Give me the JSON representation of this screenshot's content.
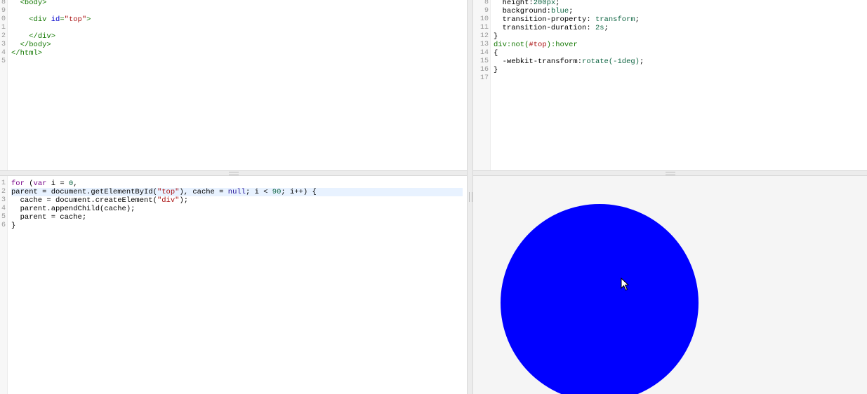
{
  "html_panel": {
    "lines": [
      {
        "n": "8",
        "parts": [
          {
            "t": "  "
          },
          {
            "t": "<body>",
            "c": "tag"
          }
        ]
      },
      {
        "n": "9",
        "parts": [
          {
            "t": ""
          }
        ]
      },
      {
        "n": "0",
        "parts": [
          {
            "t": "    "
          },
          {
            "t": "<div ",
            "c": "tag"
          },
          {
            "t": "id",
            "c": "attr"
          },
          {
            "t": "=",
            "c": "tag"
          },
          {
            "t": "\"top\"",
            "c": "str"
          },
          {
            "t": ">",
            "c": "tag"
          }
        ]
      },
      {
        "n": "1",
        "parts": [
          {
            "t": ""
          }
        ]
      },
      {
        "n": "2",
        "parts": [
          {
            "t": "    "
          },
          {
            "t": "</div>",
            "c": "tag"
          }
        ]
      },
      {
        "n": "3",
        "parts": [
          {
            "t": "  "
          },
          {
            "t": "</body>",
            "c": "tag"
          }
        ]
      },
      {
        "n": "4",
        "parts": [
          {
            "t": "</html>",
            "c": "tag"
          }
        ]
      },
      {
        "n": "5",
        "parts": [
          {
            "t": ""
          }
        ]
      }
    ]
  },
  "css_panel": {
    "lines": [
      {
        "n": "8",
        "parts": [
          {
            "t": "  height",
            "c": "prop"
          },
          {
            "t": ":"
          },
          {
            "t": "200px",
            "c": "val"
          },
          {
            "t": ";"
          }
        ]
      },
      {
        "n": "9",
        "parts": [
          {
            "t": "  background",
            "c": "prop"
          },
          {
            "t": ":"
          },
          {
            "t": "blue",
            "c": "val"
          },
          {
            "t": ";"
          }
        ]
      },
      {
        "n": "10",
        "parts": [
          {
            "t": "  transition-property",
            "c": "prop"
          },
          {
            "t": ": "
          },
          {
            "t": "transform",
            "c": "val"
          },
          {
            "t": ";"
          }
        ]
      },
      {
        "n": "11",
        "parts": [
          {
            "t": "  transition-duration",
            "c": "prop"
          },
          {
            "t": ": "
          },
          {
            "t": "2s",
            "c": "val"
          },
          {
            "t": ";"
          }
        ]
      },
      {
        "n": "12",
        "parts": [
          {
            "t": "}"
          }
        ]
      },
      {
        "n": "13",
        "parts": [
          {
            "t": "div",
            "c": "selector"
          },
          {
            "t": ":not(",
            "c": "selector"
          },
          {
            "t": "#top",
            "c": "str"
          },
          {
            "t": "):hover",
            "c": "selector"
          }
        ]
      },
      {
        "n": "14",
        "parts": [
          {
            "t": "{"
          }
        ]
      },
      {
        "n": "15",
        "parts": [
          {
            "t": "  -webkit-transform",
            "c": "prop"
          },
          {
            "t": ":"
          },
          {
            "t": "rotate",
            "c": "val"
          },
          {
            "t": "(-1deg)",
            "c": "val"
          },
          {
            "t": ";"
          }
        ]
      },
      {
        "n": "16",
        "parts": [
          {
            "t": "}"
          }
        ]
      },
      {
        "n": "17",
        "parts": [
          {
            "t": ""
          }
        ]
      }
    ]
  },
  "js_panel": {
    "lines": [
      {
        "n": "1",
        "parts": [
          {
            "t": "for",
            "c": "kw"
          },
          {
            "t": " ("
          },
          {
            "t": "var",
            "c": "kw"
          },
          {
            "t": " i = "
          },
          {
            "t": "0",
            "c": "num"
          },
          {
            "t": ","
          }
        ]
      },
      {
        "n": "2",
        "hl": true,
        "parts": [
          {
            "t": "parent = document.getElementById("
          },
          {
            "t": "\"top\"",
            "c": "str"
          },
          {
            "t": "), cache = "
          },
          {
            "t": "null",
            "c": "atom"
          },
          {
            "t": "; i < "
          },
          {
            "t": "90",
            "c": "num"
          },
          {
            "t": "; i++) {"
          }
        ]
      },
      {
        "n": "3",
        "parts": [
          {
            "t": "  cache = document.createElement("
          },
          {
            "t": "\"div\"",
            "c": "str"
          },
          {
            "t": ");"
          }
        ]
      },
      {
        "n": "4",
        "parts": [
          {
            "t": "  parent.appendChild(cache);"
          }
        ]
      },
      {
        "n": "5",
        "parts": [
          {
            "t": "  parent = cache;"
          }
        ]
      },
      {
        "n": "6",
        "parts": [
          {
            "t": "}"
          }
        ]
      }
    ]
  },
  "result_panel": {
    "shape": "blue-circle",
    "color": "#0000ff",
    "cursor_icon": "arrow-pointer-icon"
  }
}
